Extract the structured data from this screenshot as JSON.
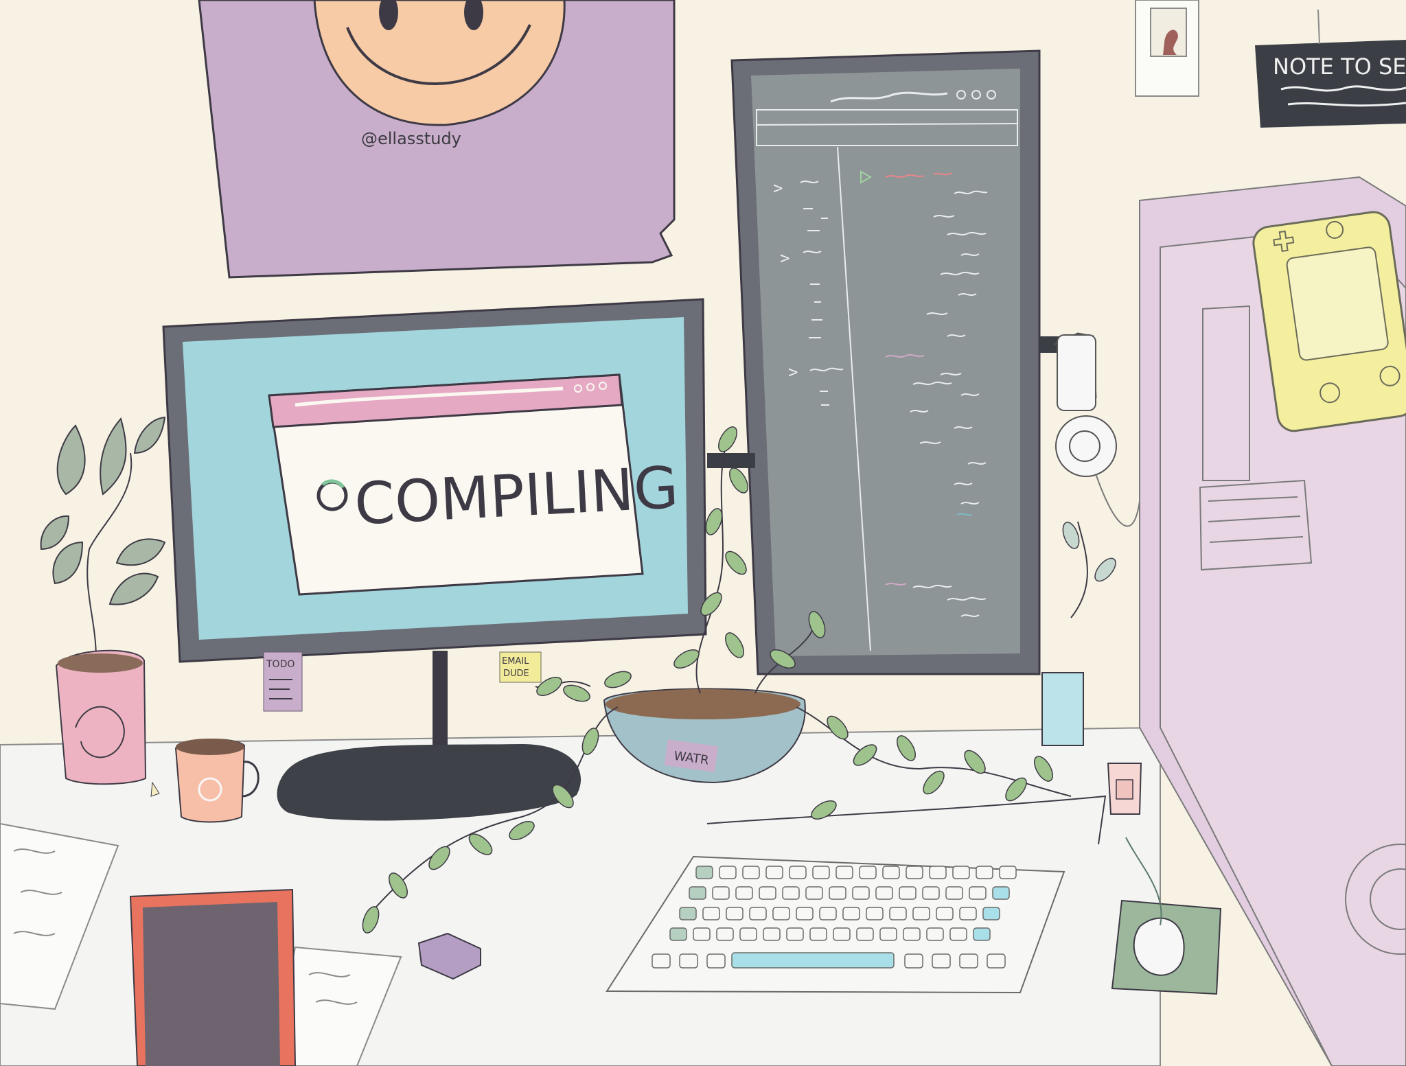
{
  "poster": {
    "handle": "@ellasstudy"
  },
  "monitor": {
    "status_text": "COMPILING"
  },
  "sticky_notes": {
    "todo": "TODO",
    "email": "EMAIL",
    "email_line2": "DUDE",
    "water": "WATR"
  },
  "wall_note": {
    "text": "NOTE TO SE"
  },
  "colors": {
    "wall": "#f7f2e4",
    "desk": "#f4f4f2",
    "poster": "#c9aecb",
    "face": "#f7cba6",
    "monitor_frame": "#6b6e76",
    "monitor_screen": "#a3d5dd",
    "dialog_titlebar": "#e6a9c4",
    "code_screen": "#8e9597",
    "pc_case": "#e3cde0",
    "gameboy": "#f3ef9f",
    "leaf": "#9ec38c",
    "book_cover": "#e8735e",
    "mousepad": "#9cb79c",
    "keyboard_accent": "#a9dfe8",
    "keyboard_accent2": "#b5cfc1"
  }
}
